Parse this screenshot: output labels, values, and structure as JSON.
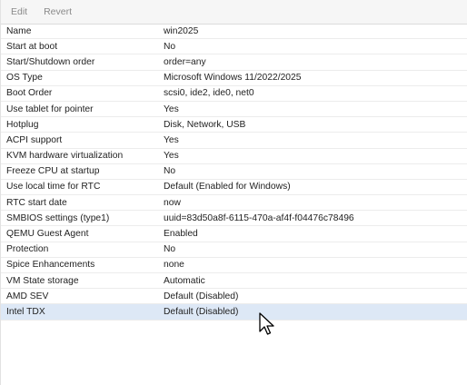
{
  "toolbar": {
    "edit_label": "Edit",
    "revert_label": "Revert"
  },
  "options": [
    {
      "key": "Name",
      "value": "win2025"
    },
    {
      "key": "Start at boot",
      "value": "No"
    },
    {
      "key": "Start/Shutdown order",
      "value": "order=any"
    },
    {
      "key": "OS Type",
      "value": "Microsoft Windows 11/2022/2025"
    },
    {
      "key": "Boot Order",
      "value": "scsi0, ide2, ide0, net0"
    },
    {
      "key": "Use tablet for pointer",
      "value": "Yes"
    },
    {
      "key": "Hotplug",
      "value": "Disk, Network, USB"
    },
    {
      "key": "ACPI support",
      "value": "Yes"
    },
    {
      "key": "KVM hardware virtualization",
      "value": "Yes"
    },
    {
      "key": "Freeze CPU at startup",
      "value": "No"
    },
    {
      "key": "Use local time for RTC",
      "value": "Default (Enabled for Windows)"
    },
    {
      "key": "RTC start date",
      "value": "now"
    },
    {
      "key": "SMBIOS settings (type1)",
      "value": "uuid=83d50a8f-6115-470a-af4f-f04476c78496"
    },
    {
      "key": "QEMU Guest Agent",
      "value": "Enabled"
    },
    {
      "key": "Protection",
      "value": "No"
    },
    {
      "key": "Spice Enhancements",
      "value": "none"
    },
    {
      "key": "VM State storage",
      "value": "Automatic"
    },
    {
      "key": "AMD SEV",
      "value": "Default (Disabled)"
    },
    {
      "key": "Intel TDX",
      "value": "Default (Disabled)"
    }
  ],
  "selected_key": "Intel TDX",
  "cursor": {
    "icon": "mouse-pointer-icon"
  }
}
